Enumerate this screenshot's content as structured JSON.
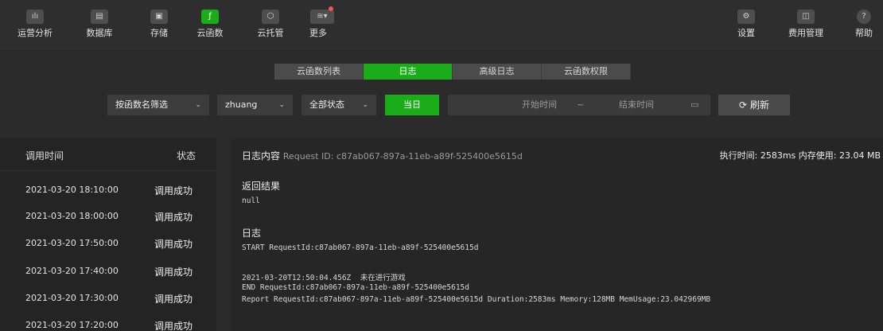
{
  "toolbar": {
    "left": [
      {
        "label": "运营分析",
        "icon": "chart-icon"
      },
      {
        "label": "数据库",
        "icon": "database-icon"
      },
      {
        "label": "存储",
        "icon": "storage-icon"
      },
      {
        "label": "云函数",
        "icon": "cloud-function-icon"
      },
      {
        "label": "云托管",
        "icon": "cloud-hosting-icon"
      },
      {
        "label": "更多",
        "icon": "layers-icon"
      }
    ],
    "right": [
      {
        "label": "设置",
        "icon": "gear-icon"
      },
      {
        "label": "费用管理",
        "icon": "billing-icon"
      },
      {
        "label": "帮助",
        "icon": "help-icon"
      }
    ]
  },
  "tabs": [
    "云函数列表",
    "日志",
    "高级日志",
    "云函数权限"
  ],
  "filters": {
    "function_filter": "按函数名筛选",
    "function_name": "zhuang",
    "status": "全部状态",
    "today": "当日",
    "start_placeholder": "开始时间",
    "range_sep": "~",
    "end_placeholder": "结束时间",
    "refresh": "刷新"
  },
  "list": {
    "header_time": "调用时间",
    "header_status": "状态",
    "rows": [
      {
        "time": "2021-03-20 18:10:00",
        "status": "调用成功"
      },
      {
        "time": "2021-03-20 18:00:00",
        "status": "调用成功"
      },
      {
        "time": "2021-03-20 17:50:00",
        "status": "调用成功"
      },
      {
        "time": "2021-03-20 17:40:00",
        "status": "调用成功"
      },
      {
        "time": "2021-03-20 17:30:00",
        "status": "调用成功"
      },
      {
        "time": "2021-03-20 17:20:00",
        "status": "调用成功"
      }
    ]
  },
  "detail": {
    "title": "日志内容",
    "request_id": "Request ID: c87ab067-897a-11eb-a89f-525400e5615d",
    "stats": "执行时间: 2583ms  内存使用: 23.04 MB",
    "return_label": "返回结果",
    "return_value": "null",
    "log_label": "日志",
    "log_lines": [
      "START RequestId:c87ab067-897a-11eb-a89f-525400e5615d",
      "2021-03-20T12:50:04.456Z  未在进行游戏",
      "END RequestId:c87ab067-897a-11eb-a89f-525400e5615d",
      "Report RequestId:c87ab067-897a-11eb-a89f-525400e5615d Duration:2583ms Memory:128MB MemUsage:23.042969MB"
    ]
  },
  "colors": {
    "accent": "#1aad19",
    "background": "#2b2b2b"
  }
}
